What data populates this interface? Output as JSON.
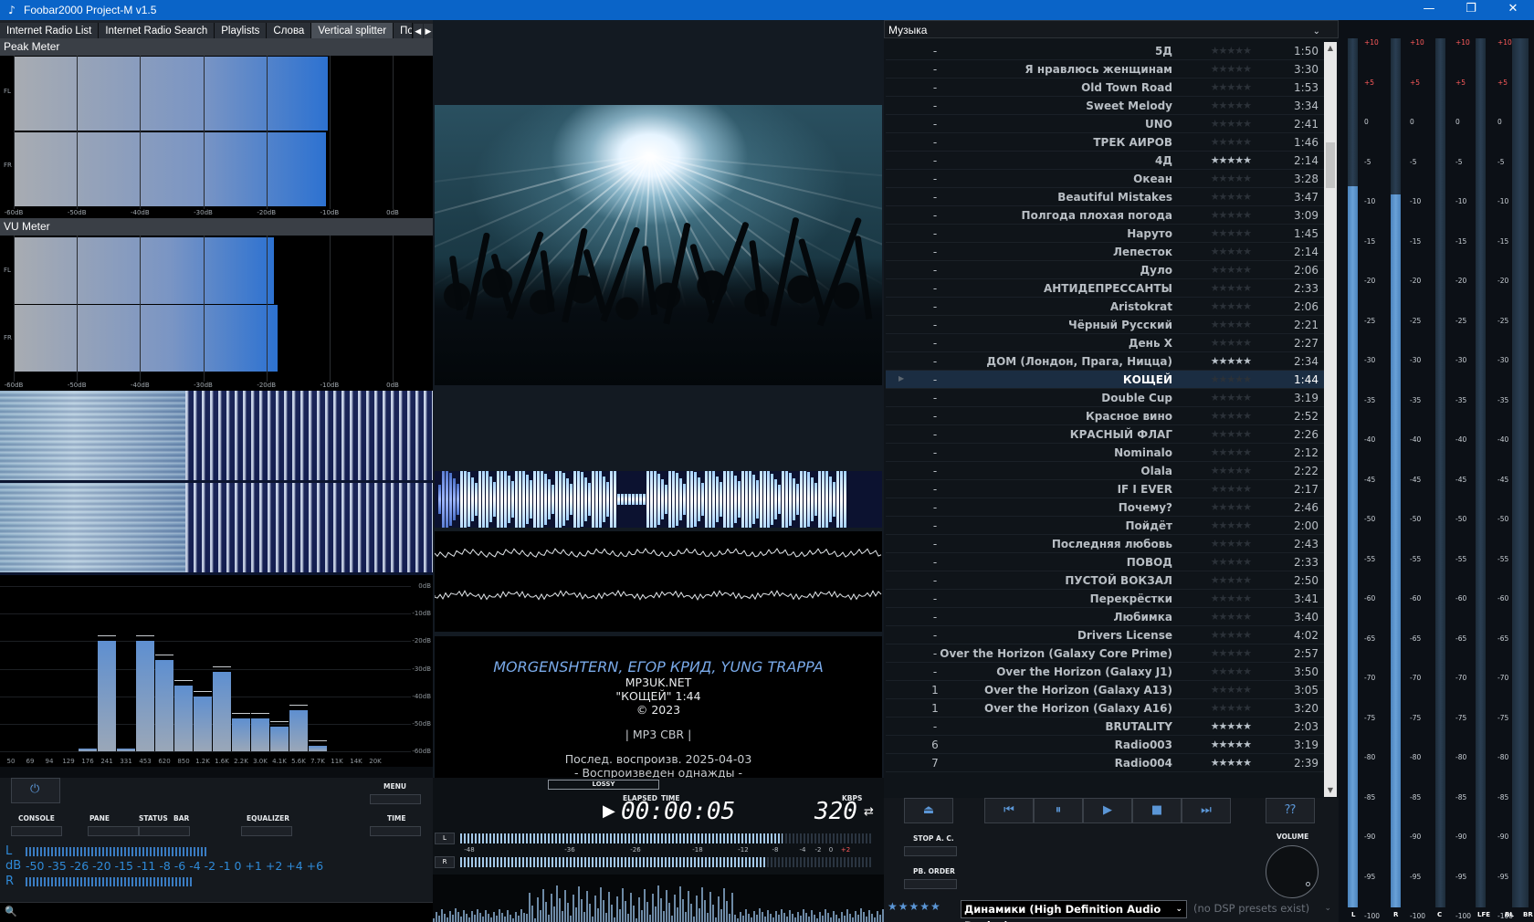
{
  "window": {
    "title": "Foobar2000 Project-M v1.5",
    "minimize": "—",
    "maximize": "❐",
    "close": "✕"
  },
  "tabs": [
    {
      "label": "Internet Radio List"
    },
    {
      "label": "Internet Radio Search"
    },
    {
      "label": "Playlists"
    },
    {
      "label": "Слова"
    },
    {
      "label": "Vertical splitter",
      "active": true
    },
    {
      "label": "По"
    }
  ],
  "peak_meter": {
    "title": "Peak Meter",
    "channels": [
      {
        "label": "FL",
        "level_pct": 81
      },
      {
        "label": "FR",
        "level_pct": 80.5
      }
    ],
    "scale": [
      "-60dB",
      "-50dB",
      "-40dB",
      "-30dB",
      "-20dB",
      "-10dB",
      "0dB"
    ]
  },
  "vu_meter": {
    "title": "VU Meter",
    "channels": [
      {
        "label": "FL",
        "level_pct": 67
      },
      {
        "label": "FR",
        "level_pct": 68
      }
    ],
    "scale": [
      "-60dB",
      "-50dB",
      "-40dB",
      "-30dB",
      "-20dB",
      "-10dB",
      "0dB"
    ]
  },
  "equalizer_spectrum": {
    "db_labels": [
      "0dB",
      "-10dB",
      "-20dB",
      "-30dB",
      "-40dB",
      "-50dB",
      "-60dB"
    ],
    "freq_labels": [
      "50",
      "69",
      "94",
      "129",
      "176",
      "241",
      "331",
      "453",
      "620",
      "850",
      "1.2K",
      "1.6K",
      "2.2K",
      "3.0K",
      "4.1K",
      "5.6K",
      "7.7K",
      "11K",
      "14K",
      "20K"
    ],
    "levels_db": [
      -60,
      -60,
      -60,
      -60,
      -59,
      -20,
      -59,
      -20,
      -27,
      -36,
      -40,
      -31,
      -48,
      -48,
      -51,
      -45,
      -58,
      -60,
      -60,
      -60
    ]
  },
  "left_controls": {
    "menu": "MENU",
    "console": "CONSOLE",
    "pane": "PANE",
    "status": "STATUS",
    "bar": "BAR",
    "equalizer": "EQUALIZER",
    "time": "TIME",
    "ch_l": "L",
    "ch_db": "dB",
    "ch_r": "R",
    "db_scale": "-50  -35  -26  -20  -15  -11   -8    -6    -4    -2    -1     0    +1   +2   +4   +6"
  },
  "now_playing": {
    "artist": "MORGENSHTERN, ЕГОР КРИД, YUNG TRAPPA",
    "album": "MP3UK.NET",
    "track": "\"КОЩЕЙ\" 1:44",
    "year": "© 2023",
    "codec": "| MP3 CBR |",
    "last_played": "Послед. воспроизв. 2025-04-03",
    "play_count": "- Воспроизведен однажды -"
  },
  "transport": {
    "lossy": "LOSSY",
    "elapsed_label": "ELAPSED",
    "time_label": "TIME",
    "time": "00:00:05",
    "kbps_label": "KBPS",
    "kbps": "320",
    "l": "L",
    "r": "R",
    "level_scale": [
      "-48",
      "-36",
      "-26",
      "-18",
      "-12",
      "-8",
      "-4",
      "-2",
      "0",
      "+2"
    ],
    "level_l_pct": 78,
    "level_r_pct": 74
  },
  "playlist": {
    "name": "Музыка",
    "rows": [
      {
        "num": "-",
        "title": "5Д",
        "rating": 0,
        "dur": "1:50"
      },
      {
        "num": "-",
        "title": "Я нравлюсь женщинам",
        "rating": 0,
        "dur": "3:30"
      },
      {
        "num": "-",
        "title": "Old Town Road",
        "rating": 0,
        "dur": "1:53"
      },
      {
        "num": "-",
        "title": "Sweet Melody",
        "rating": 0,
        "dur": "3:34"
      },
      {
        "num": "-",
        "title": "UNO",
        "rating": 0,
        "dur": "2:41"
      },
      {
        "num": "-",
        "title": "ТРЕК АИРОВ",
        "rating": 0,
        "dur": "1:46"
      },
      {
        "num": "-",
        "title": "4Д",
        "rating": 5,
        "dur": "2:14"
      },
      {
        "num": "-",
        "title": "Океан",
        "rating": 0,
        "dur": "3:28"
      },
      {
        "num": "-",
        "title": "Beautiful Mistakes",
        "rating": 0,
        "dur": "3:47"
      },
      {
        "num": "-",
        "title": "Полгода плохая погода",
        "rating": 0,
        "dur": "3:09"
      },
      {
        "num": "-",
        "title": "Наруто",
        "rating": 0,
        "dur": "1:45"
      },
      {
        "num": "-",
        "title": "Лепесток",
        "rating": 0,
        "dur": "2:14"
      },
      {
        "num": "-",
        "title": "Дуло",
        "rating": 0,
        "dur": "2:06"
      },
      {
        "num": "-",
        "title": "АНТИДЕПРЕССАНТЫ",
        "rating": 0,
        "dur": "2:33"
      },
      {
        "num": "-",
        "title": "Aristokrat",
        "rating": 0,
        "dur": "2:06"
      },
      {
        "num": "-",
        "title": "Чёрный Русский",
        "rating": 0,
        "dur": "2:21"
      },
      {
        "num": "-",
        "title": "День X",
        "rating": 0,
        "dur": "2:27"
      },
      {
        "num": "-",
        "title": "ДОМ (Лондон, Прага, Ницца)",
        "rating": 5,
        "dur": "2:34"
      },
      {
        "num": "-",
        "title": "КОЩЕЙ",
        "rating": 0,
        "dur": "1:44",
        "playing": true
      },
      {
        "num": "-",
        "title": "Double Cup",
        "rating": 0,
        "dur": "3:19"
      },
      {
        "num": "-",
        "title": "Красное вино",
        "rating": 0,
        "dur": "2:52"
      },
      {
        "num": "-",
        "title": "КРАСНЫЙ ФЛАГ",
        "rating": 0,
        "dur": "2:26"
      },
      {
        "num": "-",
        "title": "Nominalo",
        "rating": 0,
        "dur": "2:12"
      },
      {
        "num": "-",
        "title": "Olala",
        "rating": 0,
        "dur": "2:22"
      },
      {
        "num": "-",
        "title": "IF I EVER",
        "rating": 0,
        "dur": "2:17"
      },
      {
        "num": "-",
        "title": "Почему?",
        "rating": 0,
        "dur": "2:46"
      },
      {
        "num": "-",
        "title": "Пойдёт",
        "rating": 0,
        "dur": "2:00"
      },
      {
        "num": "-",
        "title": "Последняя любовь",
        "rating": 0,
        "dur": "2:43"
      },
      {
        "num": "-",
        "title": "ПОВОД",
        "rating": 0,
        "dur": "2:33"
      },
      {
        "num": "-",
        "title": "ПУСТОЙ ВОКЗАЛ",
        "rating": 0,
        "dur": "2:50"
      },
      {
        "num": "-",
        "title": "Перекрёстки",
        "rating": 0,
        "dur": "3:41"
      },
      {
        "num": "-",
        "title": "Любимка",
        "rating": 0,
        "dur": "3:40"
      },
      {
        "num": "-",
        "title": "Drivers License",
        "rating": 0,
        "dur": "4:02"
      },
      {
        "num": "-",
        "title": "Over the Horizon (Galaxy Core Prime)",
        "rating": 0,
        "dur": "2:57"
      },
      {
        "num": "-",
        "title": "Over the Horizon (Galaxy J1)",
        "rating": 0,
        "dur": "3:50"
      },
      {
        "num": "1",
        "title": "Over the Horizon (Galaxy A13)",
        "rating": 0,
        "dur": "3:05"
      },
      {
        "num": "1",
        "title": "Over the Horizon (Galaxy A16)",
        "rating": 0,
        "dur": "3:20"
      },
      {
        "num": "-",
        "title": "BRUTALITY",
        "rating": 5,
        "dur": "2:03"
      },
      {
        "num": "6",
        "title": "Radio003",
        "rating": 5,
        "dur": "3:19"
      },
      {
        "num": "7",
        "title": "Radio004",
        "rating": 5,
        "dur": "2:39"
      }
    ]
  },
  "playback_controls": {
    "stop_ac": "STOP A. C.",
    "pb_order": "PB. ORDER",
    "volume": "VOLUME",
    "device": "Динамики (High Definition Audio Device)",
    "dsp": "(no DSP presets exist)"
  },
  "channel_meters": {
    "scale": [
      "+10",
      "+5",
      "0",
      "-5",
      "-10",
      "-15",
      "-20",
      "-25",
      "-30",
      "-35",
      "-40",
      "-45",
      "-50",
      "-55",
      "-60",
      "-65",
      "-70",
      "-75",
      "-80",
      "-85",
      "-90",
      "-95",
      "-100"
    ],
    "channels": [
      {
        "label": "L",
        "level_pct": 83
      },
      {
        "label": "R",
        "level_pct": 82
      },
      {
        "label": "C",
        "level_pct": 0
      },
      {
        "label": "LFE",
        "level_pct": 0
      },
      {
        "label": "BL",
        "level_pct": 0
      },
      {
        "label": "BR",
        "level_pct": 0
      }
    ]
  }
}
